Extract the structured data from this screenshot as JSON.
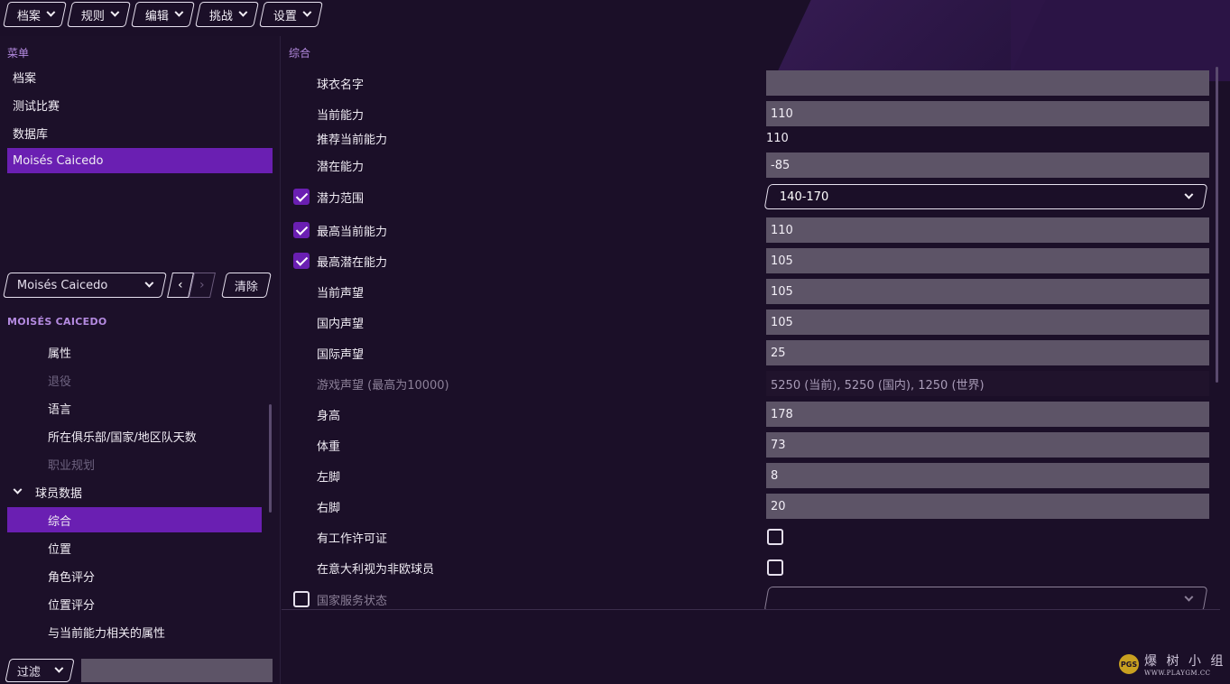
{
  "topmenu": [
    {
      "label": "档案"
    },
    {
      "label": "规则"
    },
    {
      "label": "编辑"
    },
    {
      "label": "挑战"
    },
    {
      "label": "设置"
    }
  ],
  "left": {
    "menu_label": "菜单",
    "menu_items": [
      "档案",
      "测试比赛",
      "数据库",
      "Moisés Caicedo"
    ],
    "player_select": "Moisés Caicedo",
    "clear_label": "清除",
    "player_title": "MOISÉS CAICEDO",
    "tree": [
      {
        "label": "属性",
        "state": "normal"
      },
      {
        "label": "退役",
        "state": "disabled"
      },
      {
        "label": "语言",
        "state": "normal"
      },
      {
        "label": "所在俱乐部/国家/地区队天数",
        "state": "normal"
      },
      {
        "label": "职业规划",
        "state": "disabled"
      },
      {
        "label": "球员数据",
        "state": "group"
      },
      {
        "label": "综合",
        "state": "active"
      },
      {
        "label": "位置",
        "state": "normal"
      },
      {
        "label": "角色评分",
        "state": "normal"
      },
      {
        "label": "位置评分",
        "state": "normal"
      },
      {
        "label": "与当前能力相关的属性",
        "state": "normal"
      }
    ],
    "filter_label": "过滤",
    "filter_value": ""
  },
  "right": {
    "section_label": "综合",
    "rows": [
      {
        "label": "球衣名字",
        "type": "field",
        "value": ""
      },
      {
        "label": "当前能力",
        "type": "field",
        "value": "110"
      },
      {
        "label": "推荐当前能力",
        "type": "plain",
        "value": "110"
      },
      {
        "label": "潜在能力",
        "type": "field",
        "value": "-85"
      },
      {
        "label": "潜力范围",
        "type": "select",
        "value": "140-170",
        "checkbox": true
      },
      {
        "label": "最高当前能力",
        "type": "field",
        "value": "110",
        "checkbox": true
      },
      {
        "label": "最高潜在能力",
        "type": "field",
        "value": "105",
        "checkbox": true
      },
      {
        "label": "当前声望",
        "type": "field",
        "value": "105"
      },
      {
        "label": "国内声望",
        "type": "field",
        "value": "105"
      },
      {
        "label": "国际声望",
        "type": "field",
        "value": "25"
      },
      {
        "label": "游戏声望 (最高为10000)",
        "type": "dark",
        "value": "5250 (当前), 5250 (国内), 1250 (世界)"
      },
      {
        "label": "身高",
        "type": "field",
        "value": "178"
      },
      {
        "label": "体重",
        "type": "field",
        "value": "73"
      },
      {
        "label": "左脚",
        "type": "field",
        "value": "8"
      },
      {
        "label": "右脚",
        "type": "field",
        "value": "20"
      },
      {
        "label": "有工作许可证",
        "type": "tick",
        "value": ""
      },
      {
        "label": "在意大利视为非欧球员",
        "type": "tick",
        "value": ""
      },
      {
        "label": "国家服务状态",
        "type": "select",
        "value": "",
        "checkbox": false
      }
    ]
  },
  "watermark": {
    "big": "爆 树 小 组",
    "small": "WWW.PLAYGM.CC",
    "logo": "PGS"
  },
  "colors": {
    "accent": "#6a1fb2",
    "background": "#1b0f28",
    "label": "#b48ae0",
    "field": "#5d5467"
  }
}
